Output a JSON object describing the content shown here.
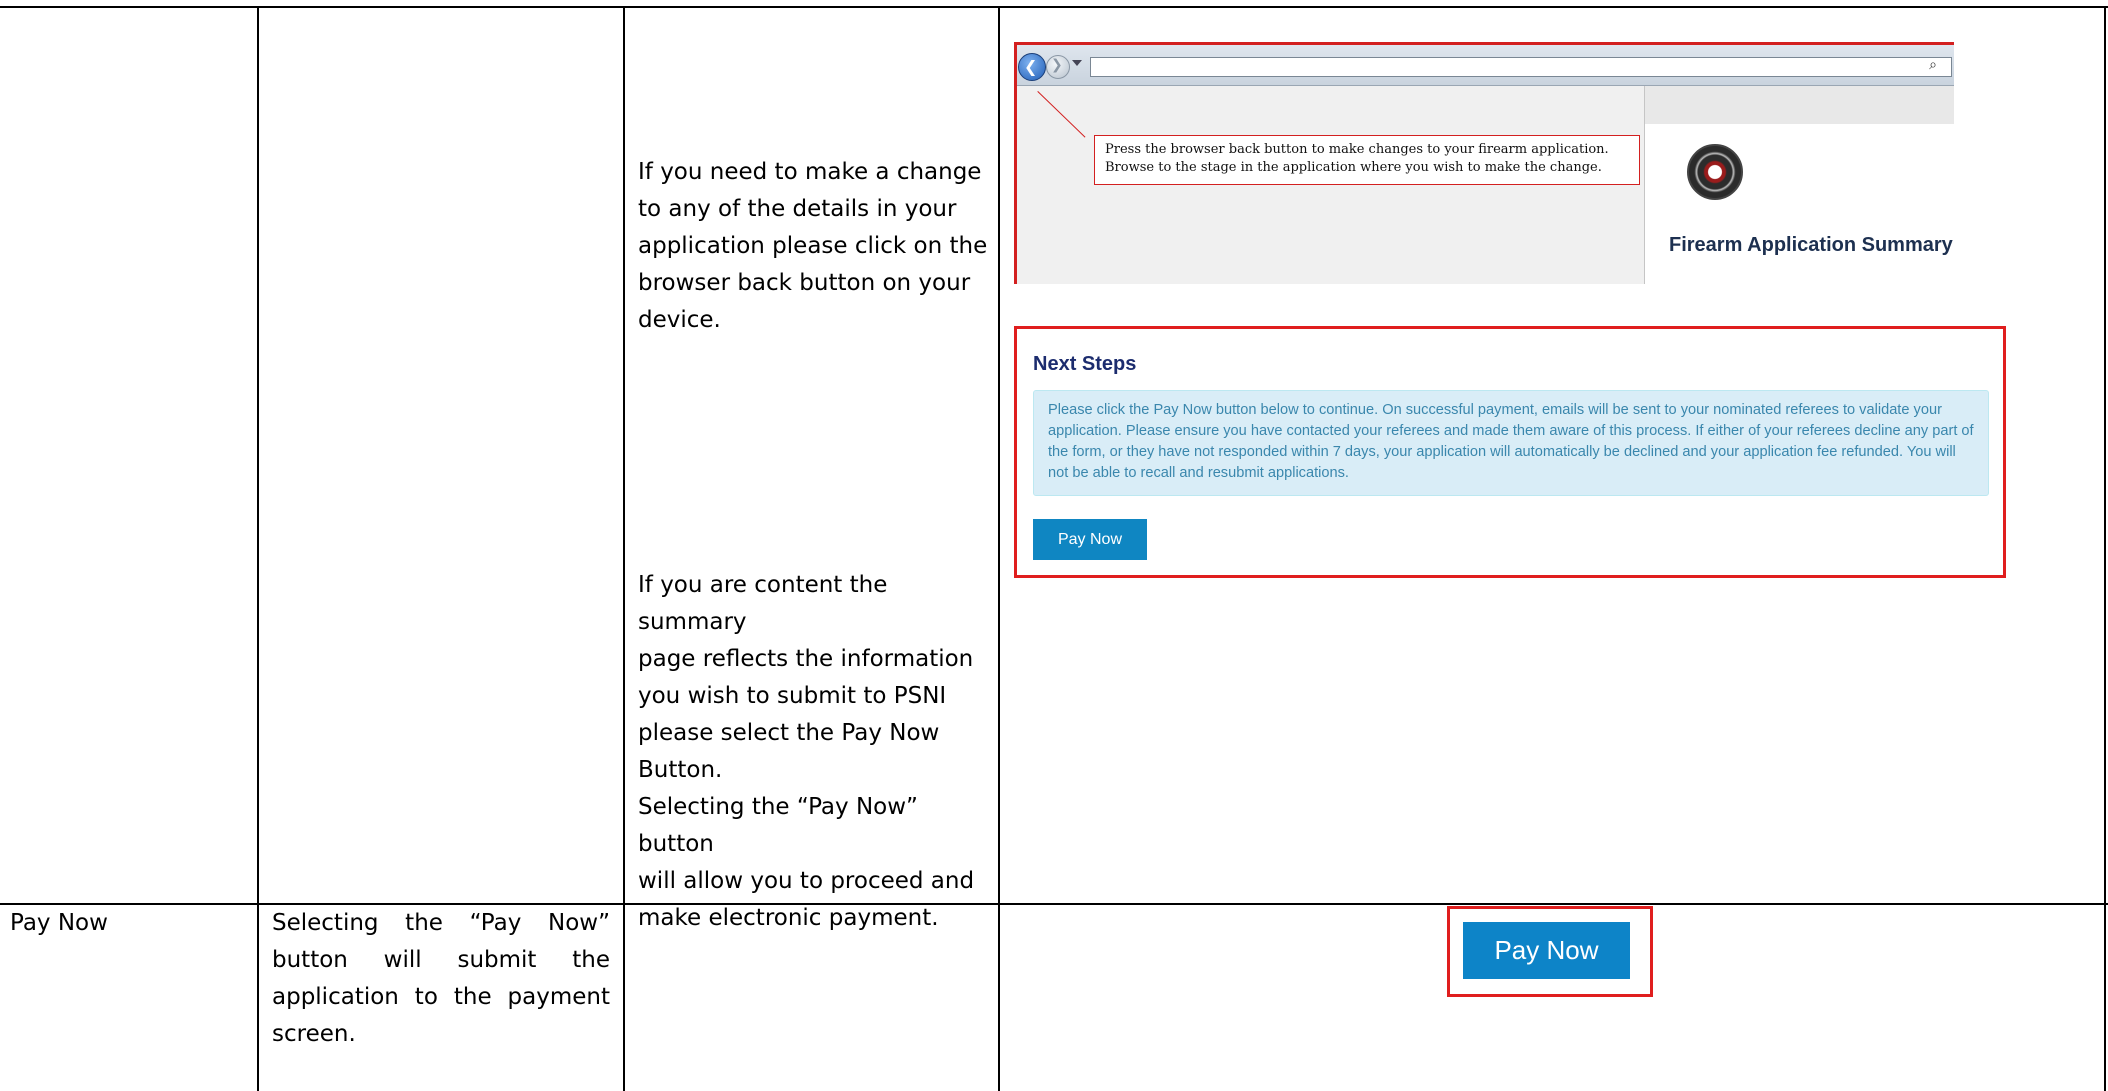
{
  "instructions": {
    "change_details": [
      "If you need to make a change",
      "to any of the details in your",
      "application please click on the",
      "browser back button on your",
      "device."
    ],
    "content_summary": [
      "If you are content the summary",
      "page reflects the information",
      "you wish to submit to PSNI",
      "please select the Pay Now",
      "Button.",
      "Selecting the “Pay Now” button",
      "will allow you to proceed and",
      "make electronic payment."
    ]
  },
  "pay_now_row": {
    "label": "Pay Now",
    "description": [
      "Selecting the “Pay Now”",
      "button will submit the",
      "application to the payment",
      "screen."
    ]
  },
  "browser_screenshot": {
    "callout_lines": [
      "Press the browser back button to make changes to your firearm application.",
      "Browse to the stage in the application where you wish to make the change."
    ],
    "page_title": "Firearm Application Summary",
    "icons": [
      "back-arrow-icon",
      "forward-arrow-icon",
      "search-icon",
      "crest-icon"
    ]
  },
  "next_steps": {
    "title": "Next Steps",
    "info_text": "Please click the Pay Now button below to continue. On successful payment, emails will be sent to your nominated referees to validate your application. Please ensure you have contacted your referees and made them aware of this process. If either of your referees decline any part of the form, or they have not responded within 7 days, your application will automatically be declined and your application fee refunded. You will not be able to recall and resubmit applications.",
    "button_label": "Pay Now"
  },
  "pay_button_large": {
    "label": "Pay Now"
  },
  "colors": {
    "highlight_border": "#e01e1e",
    "button_blue": "#0f86c2",
    "info_bg": "#d9edf7",
    "info_text": "#3a87ad",
    "heading_navy": "#1c2c6e"
  }
}
